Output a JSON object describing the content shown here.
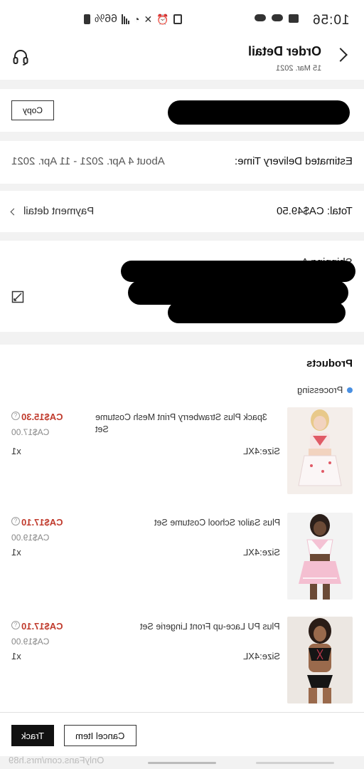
{
  "status_bar": {
    "time": "10:56",
    "battery": "66%",
    "icons": [
      "cloud-icon",
      "image-icon",
      "cat-icon",
      "signal-icon",
      "wifi-icon",
      "mute-icon",
      "alarm-icon",
      "battery-icon"
    ]
  },
  "header": {
    "title": "Order Detail",
    "date": "15 Mar. 2021",
    "icons": [
      "back-chevron-icon",
      "headset-icon"
    ]
  },
  "order_number": {
    "copy_label": "Copy"
  },
  "delivery": {
    "label": "Estimated Delivery Time:",
    "value": "About 4 Apr. 2021 - 11 Apr. 2021"
  },
  "payment": {
    "total_label": "Total: CA$49.50",
    "detail_label": "Payment detail"
  },
  "shipping": {
    "partial_label": "Shipping A"
  },
  "products": {
    "title": "Products",
    "status": "Processing",
    "items": [
      {
        "name": "3pack Plus Strawberry Print Mesh Costume Set",
        "price": "CA$15.30",
        "original_price": "CA$17.00",
        "size": "Size:4XL",
        "qty": "x1"
      },
      {
        "name": "Plus Sailor School Costume Set",
        "price": "CA$17.10",
        "original_price": "CA$19.00",
        "size": "Size:4XL",
        "qty": "x1"
      },
      {
        "name": "Plus PU Lace-up Front Lingerie Set",
        "price": "CA$17.10",
        "original_price": "CA$19.00",
        "size": "Size:4XL",
        "qty": "x1"
      }
    ]
  },
  "actions": {
    "track": "Track",
    "cancel": "Cancel Item"
  },
  "watermark": "OnlyFans.com/mrs.h89",
  "colors": {
    "price_red": "#c0392b",
    "status_blue": "#4a90e2",
    "primary_black": "#111111"
  }
}
